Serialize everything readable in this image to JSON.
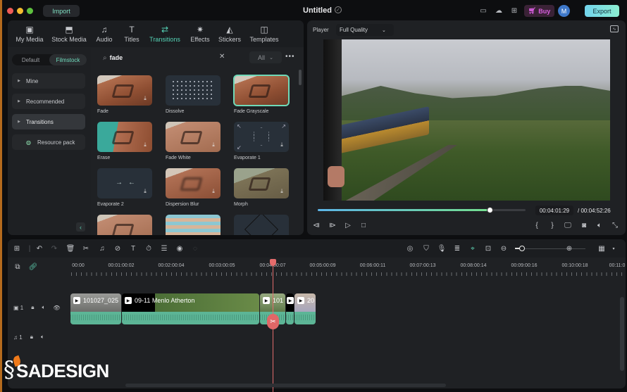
{
  "titlebar": {
    "import_label": "Import",
    "doc_title": "Untitled",
    "buy_label": "Buy",
    "avatar_initial": "M",
    "export_label": "Export",
    "colors": {
      "accent": "#55d3b6",
      "buy": "#d85ee0",
      "avatar": "#3e78c9"
    }
  },
  "library": {
    "tabs": [
      {
        "label": "My Media",
        "icon": "media-icon",
        "glyph": "▣"
      },
      {
        "label": "Stock Media",
        "icon": "stock-media-icon",
        "glyph": "⬒"
      },
      {
        "label": "Audio",
        "icon": "music-note-icon",
        "glyph": "♫"
      },
      {
        "label": "Titles",
        "icon": "text-icon",
        "glyph": "T"
      },
      {
        "label": "Transitions",
        "icon": "transitions-icon",
        "glyph": "⇄",
        "active": true
      },
      {
        "label": "Effects",
        "icon": "effects-icon",
        "glyph": "✷"
      },
      {
        "label": "Stickers",
        "icon": "stickers-icon",
        "glyph": "◭"
      },
      {
        "label": "Templates",
        "icon": "templates-icon",
        "glyph": "◫"
      }
    ],
    "segment": {
      "left": "Default",
      "right": "Filmstock",
      "selected": "Filmstock"
    },
    "sidebar": [
      {
        "label": "Mine"
      },
      {
        "label": "Recommended"
      },
      {
        "label": "Transitions",
        "selected": true
      },
      {
        "label": "Resource pack"
      }
    ],
    "search": {
      "value": "fade"
    },
    "filter": {
      "value": "All"
    },
    "items": [
      {
        "label": "Fade"
      },
      {
        "label": "Dissolve"
      },
      {
        "label": "Fade Grayscale",
        "selected": true
      },
      {
        "label": "Erase"
      },
      {
        "label": "Fade White"
      },
      {
        "label": "Evaporate 1"
      },
      {
        "label": "Evaporate 2"
      },
      {
        "label": "Dispersion Blur"
      },
      {
        "label": "Morph"
      },
      {
        "label": ""
      },
      {
        "label": ""
      },
      {
        "label": ""
      }
    ]
  },
  "player": {
    "label": "Player",
    "quality": "Full Quality",
    "progress": 0.828,
    "current_time": "00:04:01:29",
    "total_time": "/ 00:04:52:26"
  },
  "timeline": {
    "ruler": [
      "00:00",
      "00:01:00:02",
      "00:02:00:04",
      "00:03:00:05",
      "00:04:00:07",
      "00:05:00:09",
      "00:06:00:11",
      "00:07:00:13",
      "00:08:00:14",
      "00:09:00:16",
      "00:10:00:18",
      "00:11:0"
    ],
    "zoom_level": 0.1,
    "tracks": {
      "video": {
        "index": "1"
      },
      "audio": {
        "index": "1"
      }
    },
    "clips": [
      {
        "name": "101027_025"
      },
      {
        "name": "09-11 Menlo Atherton"
      },
      {
        "name": "101"
      },
      {
        "name": ""
      },
      {
        "name": "20"
      }
    ]
  },
  "watermark": {
    "text": "SADESIGN"
  }
}
